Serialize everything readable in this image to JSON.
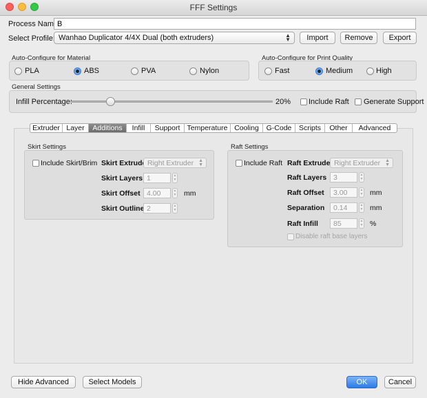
{
  "window": {
    "title": "FFF Settings"
  },
  "process": {
    "label": "Process Name:",
    "value": "B"
  },
  "profile": {
    "label": "Select Profile:",
    "selected": "Wanhao Duplicator 4/4X Dual (both extruders)",
    "import_label": "Import",
    "remove_label": "Remove",
    "export_label": "Export"
  },
  "material": {
    "title": "Auto-Configure for Material",
    "options": [
      "PLA",
      "ABS",
      "PVA",
      "Nylon"
    ],
    "selected": "ABS"
  },
  "quality": {
    "title": "Auto-Configure for Print Quality",
    "options": [
      "Fast",
      "Medium",
      "High"
    ],
    "selected": "Medium"
  },
  "general": {
    "title": "General Settings",
    "infill_label": "Infill Percentage:",
    "infill_value": "20%",
    "infill_fraction": 0.2,
    "include_raft_label": "Include Raft",
    "generate_support_label": "Generate Support"
  },
  "tabs": {
    "items": [
      "Extruder",
      "Layer",
      "Additions",
      "Infill",
      "Support",
      "Temperature",
      "Cooling",
      "G-Code",
      "Scripts",
      "Other",
      "Advanced"
    ],
    "active": "Additions"
  },
  "skirt": {
    "title": "Skirt Settings",
    "include_label": "Include Skirt/Brim",
    "extruder_label": "Skirt Extruder",
    "extruder_value": "Right Extruder",
    "layers_label": "Skirt Layers",
    "layers_value": "1",
    "offset_label": "Skirt Offset",
    "offset_value": "4.00",
    "offset_unit": "mm",
    "outlines_label": "Skirt Outlines",
    "outlines_value": "2"
  },
  "raft": {
    "title": "Raft Settings",
    "include_label": "Include Raft",
    "extruder_label": "Raft Extruder",
    "extruder_value": "Right Extruder",
    "layers_label": "Raft Layers",
    "layers_value": "3",
    "offset_label": "Raft Offset",
    "offset_value": "3.00",
    "offset_unit": "mm",
    "separation_label": "Separation",
    "separation_value": "0.14",
    "separation_unit": "mm",
    "infill_label": "Raft Infill",
    "infill_value": "85",
    "infill_unit": "%",
    "disable_base_label": "Disable raft base layers"
  },
  "footer": {
    "hide_advanced_label": "Hide Advanced",
    "select_models_label": "Select Models",
    "ok_label": "OK",
    "cancel_label": "Cancel"
  },
  "colors": {
    "accent": "#2c7ae8",
    "active_tab": "#7a7a7a"
  }
}
